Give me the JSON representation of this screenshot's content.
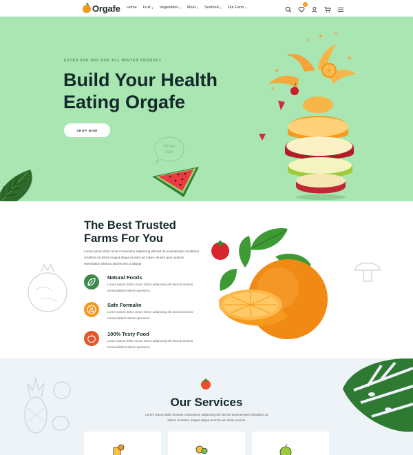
{
  "brand": {
    "name": "Orgafe"
  },
  "nav": {
    "items": [
      {
        "label": "Home",
        "has_dropdown": false
      },
      {
        "label": "Fruit",
        "has_dropdown": true
      },
      {
        "label": "Vegetables",
        "has_dropdown": true
      },
      {
        "label": "Meat",
        "has_dropdown": true
      },
      {
        "label": "Seafood",
        "has_dropdown": true
      },
      {
        "label": "Our Farm",
        "has_dropdown": true
      }
    ],
    "caret": "▾"
  },
  "header_icons": {
    "search": "search-icon",
    "wishlist": "heart-icon",
    "wishlist_count": "0",
    "user": "user-icon",
    "cart": "cart-icon",
    "menu": "hamburger-menu-icon"
  },
  "hero": {
    "kicker": "EXTRA 50% OFF FOR ALL WINTER PRODUCT",
    "title_line1": "Build Your Health",
    "title_line2": "Eating Orgafe",
    "button_label": "SHOP NOW",
    "bubble_text": "Winter Sale",
    "background": "#a9e6b1"
  },
  "about": {
    "title_line1": "The Best Trusted",
    "title_line2": "Farms For You",
    "text": "Lorem ipsum dolor amet consectetur adipiscing elit sed do eiusmtempor incididunt ut labore et dolore magna aliqua ut enim ad minim veniam quis nostrud exercitation ullamco laboris nisi ut aliquip",
    "features": [
      {
        "title": "Natural Foods",
        "text": "Lorem ipsum dolor cones ctetur adipiscing elit sed do eiusmo tomincididunt labore aperiorns.",
        "color": "#3b8a4a"
      },
      {
        "title": "Safe Formalin",
        "text": "Lorem ipsum dolor cones ctetur adipiscing elit sed do eiusmo tomincididunt labore aperiorns.",
        "color": "#f39a1e"
      },
      {
        "title": "100% Testy Food",
        "text": "Lorem ipsum dolor cones ctetur adipiscing elit sed do eiusmo tomincididunt labore aperiorns.",
        "color": "#e2572b"
      }
    ]
  },
  "services": {
    "title": "Our Services",
    "text": "Lorem ipsum dolor sit amet consectetur adipiscing elit sed do eiusmtempor incididunt ut labore et dolore magna aliqua ut enim ad minim veniam",
    "cards": [
      {
        "icon": "juice-icon"
      },
      {
        "icon": "fruit-basket-icon"
      },
      {
        "icon": "apple-icon"
      }
    ]
  },
  "colors": {
    "accent": "#f39a1e",
    "dark": "#13292b",
    "hero_bg": "#a9e6b1",
    "services_bg": "#eef3f8"
  }
}
